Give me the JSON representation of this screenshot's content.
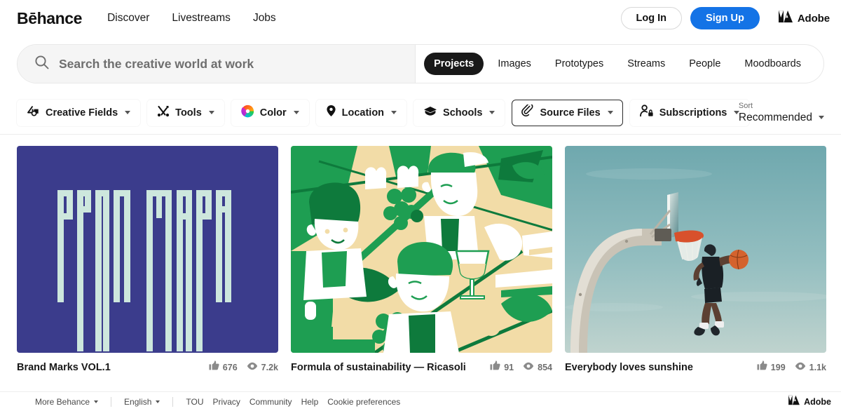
{
  "header": {
    "logo": "Bēhance",
    "nav_links": [
      {
        "label": "Discover"
      },
      {
        "label": "Livestreams"
      },
      {
        "label": "Jobs"
      }
    ],
    "login_label": "Log In",
    "signup_label": "Sign Up",
    "adobe_label": "Adobe",
    "signup_color": "#1473E6"
  },
  "search": {
    "placeholder": "Search the creative world at work",
    "value": "",
    "icon": "search-icon",
    "tabs": [
      {
        "label": "Projects",
        "active": true
      },
      {
        "label": "Images",
        "active": false
      },
      {
        "label": "Prototypes",
        "active": false
      },
      {
        "label": "Streams",
        "active": false
      },
      {
        "label": "People",
        "active": false
      },
      {
        "label": "Moodboards",
        "active": false
      }
    ]
  },
  "filters": {
    "chips": [
      {
        "label": "Creative Fields",
        "icon": "creative-fields-icon",
        "bordered": false
      },
      {
        "label": "Tools",
        "icon": "tools-icon",
        "bordered": false
      },
      {
        "label": "Color",
        "icon": "color-wheel-icon",
        "bordered": false
      },
      {
        "label": "Location",
        "icon": "location-pin-icon",
        "bordered": false
      },
      {
        "label": "Schools",
        "icon": "graduation-cap-icon",
        "bordered": false
      },
      {
        "label": "Source Files",
        "icon": "paperclip-icon",
        "bordered": true
      },
      {
        "label": "Subscriptions",
        "icon": "person-lock-icon",
        "bordered": false
      }
    ],
    "sort_label": "Sort",
    "sort_value": "Recommended"
  },
  "projects": [
    {
      "title": "Brand Marks VOL.1",
      "likes": "676",
      "views": "7.2k",
      "thumb": "brand-marks-barcode-typography",
      "colors": {
        "bg": "#3B3C8C",
        "fg": "#CDE7DD"
      }
    },
    {
      "title": "Formula of sustainability — Ricasoli",
      "likes": "91",
      "views": "854",
      "thumb": "grape-harvest-illustration",
      "colors": {
        "bg": "#F2DCA7",
        "green": "#1E9E52",
        "dark_green": "#0E7A3C",
        "white": "#FFFFFF"
      }
    },
    {
      "title": "Everybody loves sunshine",
      "likes": "199",
      "views": "1.1k",
      "thumb": "basketball-dunk-photo",
      "colors": {
        "sky": "#7FB3B8",
        "hoop": "#D8512C",
        "pole": "#CFC9BC"
      }
    }
  ],
  "footer": {
    "more_behance": "More Behance",
    "language": "English",
    "links": [
      {
        "label": "TOU"
      },
      {
        "label": "Privacy"
      },
      {
        "label": "Community"
      },
      {
        "label": "Help"
      },
      {
        "label": "Cookie preferences"
      }
    ],
    "adobe_label": "Adobe"
  }
}
